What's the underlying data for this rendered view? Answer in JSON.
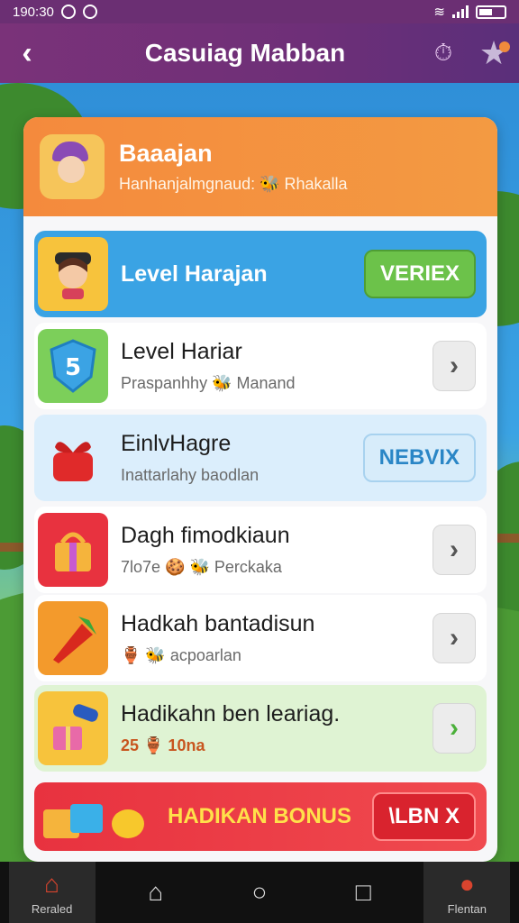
{
  "status_bar": {
    "time": "190:30"
  },
  "app_bar": {
    "title": "Casuiag Mabban",
    "back_glyph": "‹",
    "timer_glyph": "⏱",
    "star_glyph": "★"
  },
  "header": {
    "title": "Baaajan",
    "subtitle": "Hanhanjalmgnaud: 🐝 Rhakalla"
  },
  "rows": [
    {
      "title": "Level Harajan",
      "subtitle": "",
      "button": "VERIEX",
      "icon": "avatar-girl-icon"
    },
    {
      "title": "Level Hariar",
      "subtitle": "Praspanhhy 🐝 Manand",
      "button": "›",
      "icon": "shield-badge-icon"
    },
    {
      "title": "EinlvHagre",
      "subtitle": "Inattarlahy baodlan",
      "button": "NEBVIX",
      "icon": "gift-bow-icon"
    },
    {
      "title": "Dagh fimodkiaun",
      "subtitle": "7lo7e 🍪 🐝 Perckaka",
      "button": "›",
      "icon": "gift-box-icon"
    },
    {
      "title": "Hadkah bantadisun",
      "subtitle": "🏺 🐝 acpoarlan",
      "button": "›",
      "icon": "rocket-icon"
    },
    {
      "title": "Hadikahn ben leariag.",
      "subtitle": "25 🏺 10na",
      "button": "›",
      "icon": "telescope-gift-icon"
    }
  ],
  "bonus": {
    "label": "HADIKAN BONUS",
    "button": "\\LBN X"
  },
  "nav": {
    "left_label": "Reraled",
    "right_label": "Flentan"
  },
  "colors": {
    "accent": "#6b2f73",
    "header": "#f48a3d",
    "blue_row": "#3aa3e4",
    "green_button": "#6cc24a",
    "bonus": "#e8323f"
  }
}
